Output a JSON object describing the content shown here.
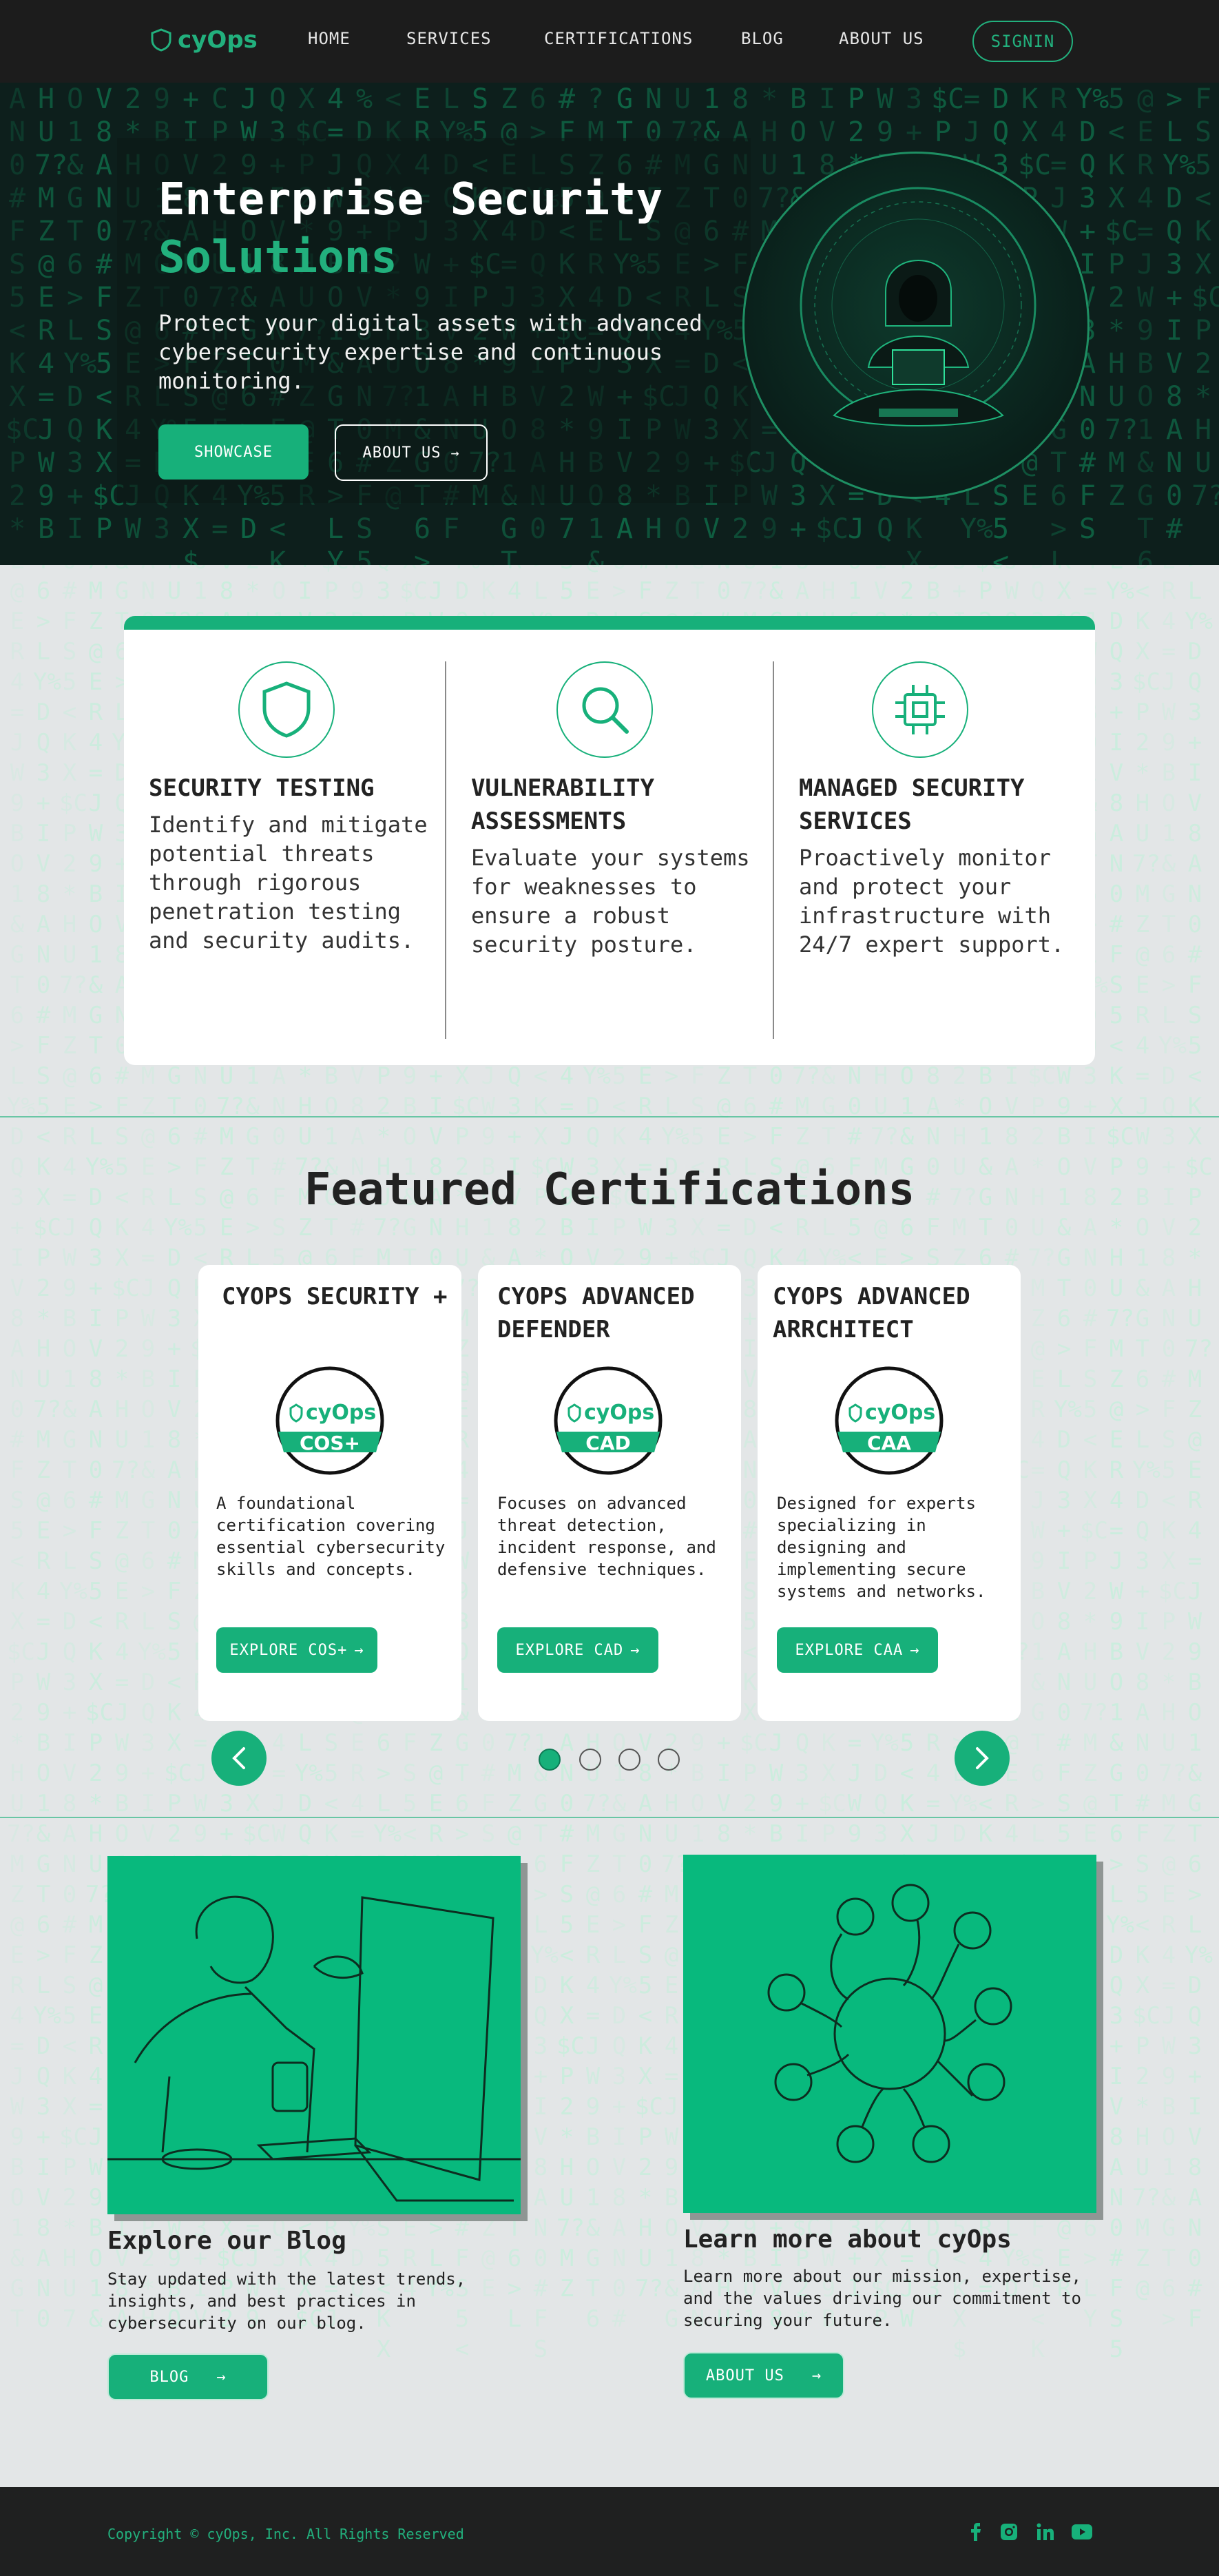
{
  "brand": {
    "name": "cyOps",
    "accent": "#17b07a",
    "dark": "#1c1c1c"
  },
  "nav": {
    "links": [
      "HOME",
      "SERVICES",
      "CERTIFICATIONS",
      "BLOG",
      "ABOUT US"
    ],
    "signin": "SIGNIN"
  },
  "hero": {
    "title_line1": "Enterprise Security",
    "title_line2": "Solutions",
    "description": "Protect your digital assets with advanced cybersecurity expertise and continuous monitoring.",
    "showcase_label": "SHOWCASE",
    "about_label": "ABOUT US",
    "image_icon": "hacker-illustration"
  },
  "services": [
    {
      "icon": "shield-icon",
      "title": "SECURITY TESTING",
      "description": "Identify and mitigate potential threats through rigorous penetration testing and security audits."
    },
    {
      "icon": "search-icon",
      "title": "VULNERABILITY ASSESSMENTS",
      "description": "Evaluate your systems for weaknesses to ensure a robust security posture."
    },
    {
      "icon": "chip-icon",
      "title": "MANAGED SECURITY SERVICES",
      "description": "Proactively monitor and protect your infrastructure with 24/7 expert support."
    }
  ],
  "certifications": {
    "heading": "Featured Certifications",
    "cards": [
      {
        "title": "CYOPS SECURITY +",
        "badge_brand": "cyOps",
        "badge_code": "COS+",
        "description": "A foundational certification covering essential cybersecurity skills and concepts.",
        "button": "EXPLORE COS+"
      },
      {
        "title": "CYOPS ADVANCED DEFENDER",
        "badge_brand": "cyOps",
        "badge_code": "CAD",
        "description": "Focuses on advanced threat detection, incident response, and defensive techniques.",
        "button": "EXPLORE CAD"
      },
      {
        "title": "CYOPS ADVANCED ARRCHITECT",
        "badge_brand": "cyOps",
        "badge_code": "CAA",
        "description": "Designed for experts specializing in designing and implementing secure systems and networks.",
        "button": "EXPLORE CAA"
      }
    ],
    "pagination": {
      "total": 4,
      "active": 1
    }
  },
  "blog": {
    "title": "Explore our Blog",
    "description": "Stay updated with the latest trends, insights, and best practices in cybersecurity on our blog.",
    "button": "BLOG"
  },
  "about": {
    "title": "Learn more about cyOps",
    "description": "Learn more about our mission, expertise, and the values driving our commitment to securing your future.",
    "button": "ABOUT US"
  },
  "footer": {
    "copyright": "Copyright © cyOps, Inc. All Rights Reserved",
    "social": [
      "facebook-icon",
      "instagram-icon",
      "linkedin-icon",
      "youtube-icon"
    ]
  }
}
